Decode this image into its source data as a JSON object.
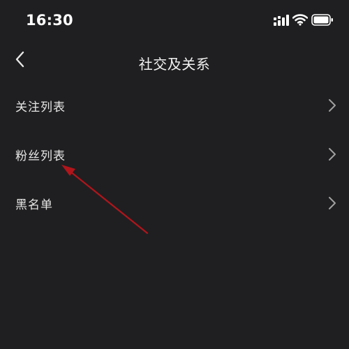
{
  "status_bar": {
    "time": "16:30",
    "icons": [
      "signal-icon",
      "wifi-icon",
      "battery-icon"
    ]
  },
  "nav": {
    "back_icon": "chevron-left-icon",
    "title": "社交及关系"
  },
  "list": {
    "items": [
      {
        "label": "关注列表",
        "icon": "chevron-right-icon"
      },
      {
        "label": "粉丝列表",
        "icon": "chevron-right-icon"
      },
      {
        "label": "黑名单",
        "icon": "chevron-right-icon"
      }
    ]
  },
  "colors": {
    "background": "#1f1f21",
    "text": "#e6e6e6",
    "chevron": "#a0a0a0",
    "annotation_arrow": "#b0151b"
  }
}
